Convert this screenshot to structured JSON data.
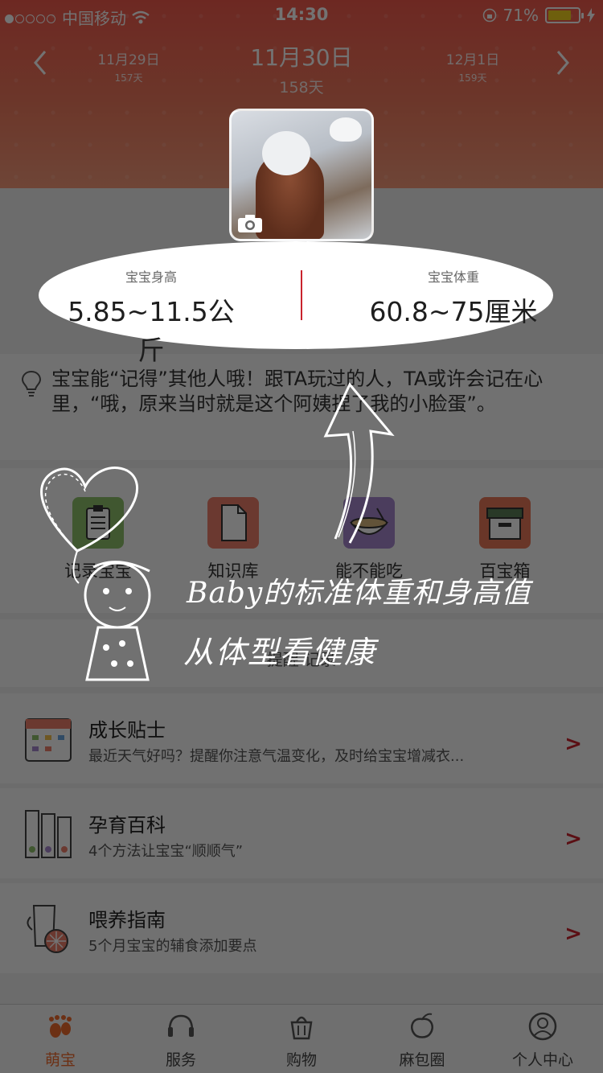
{
  "status": {
    "carrier": "中国移动",
    "time": "14:30",
    "battery": "71%"
  },
  "dates": {
    "prev": {
      "date": "11月29日",
      "day": "157天"
    },
    "current": {
      "date": "11月30日",
      "day": "158天"
    },
    "next": {
      "date": "12月1日",
      "day": "159天"
    }
  },
  "stats": {
    "left": {
      "label": "宝宝身高",
      "value": "5.85~11.5公斤"
    },
    "right": {
      "label": "宝宝体重",
      "value": "60.8~75厘米"
    }
  },
  "tip": {
    "text": "宝宝能“记得”其他人哦！跟TA玩过的人，TA或许会记在心里，“哦，原来当时就是这个阿姨捏了我的小脸蛋”。"
  },
  "grid": [
    {
      "label": "记录宝宝",
      "icon": "clipboard-icon",
      "color": "#8fc06a"
    },
    {
      "label": "知识库",
      "icon": "document-icon",
      "color": "#ee7e6a"
    },
    {
      "label": "能不能吃",
      "icon": "bowl-icon",
      "color": "#a787cf"
    },
    {
      "label": "百宝箱",
      "icon": "box-icon",
      "color": "#e8785a"
    }
  ],
  "segment": {
    "label": "提醒 记录"
  },
  "list": [
    {
      "title": "成长贴士",
      "sub": "最近天气好吗？提醒你注意气温变化，及时给宝宝增减衣..."
    },
    {
      "title": "孕育百科",
      "sub": "4个方法让宝宝“顺顺气”"
    },
    {
      "title": "喂养指南",
      "sub": "5个月宝宝的辅食添加要点"
    }
  ],
  "tabs": [
    {
      "label": "萌宝",
      "icon": "footprint-icon",
      "active": true
    },
    {
      "label": "服务",
      "icon": "headset-icon"
    },
    {
      "label": "购物",
      "icon": "basket-icon"
    },
    {
      "label": "麻包圈",
      "icon": "peach-icon"
    },
    {
      "label": "个人中心",
      "icon": "user-icon"
    }
  ],
  "annotation": {
    "line1": "Baby的标准体重和身高值",
    "line2": "从体型看健康"
  },
  "colors": {
    "accent": "#c9232d",
    "header": "#f25a4d",
    "active_tab": "#f06a2d"
  }
}
